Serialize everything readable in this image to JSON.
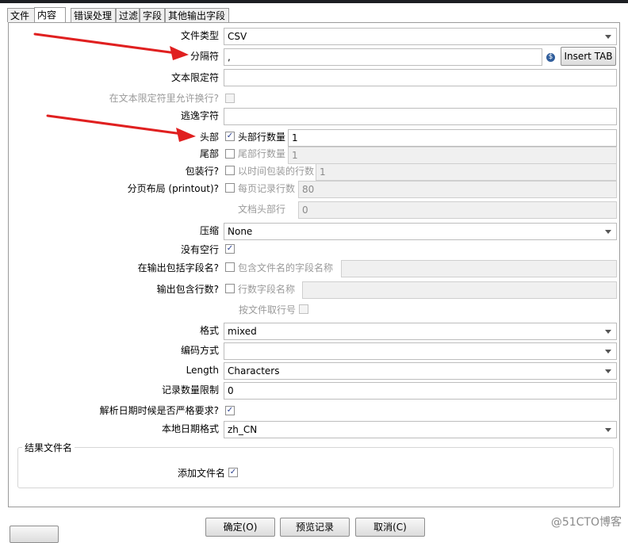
{
  "tabs": [
    "文件",
    "内容",
    "错误处理",
    "过滤",
    "字段",
    "其他输出字段"
  ],
  "form": {
    "file_type": {
      "label": "文件类型",
      "value": "CSV"
    },
    "separator": {
      "label": "分隔符",
      "value": ",",
      "insert_tab": "Insert TAB"
    },
    "enclosure": {
      "label": "文本限定符",
      "value": ""
    },
    "allow_breaks": {
      "label": "在文本限定符里允许换行?"
    },
    "escape": {
      "label": "逃逸字符",
      "value": ""
    },
    "header": {
      "label": "头部",
      "checked": true,
      "sub_label": "头部行数量",
      "value": "1"
    },
    "footer": {
      "label": "尾部",
      "checked": false,
      "sub_label": "尾部行数量",
      "value": "1"
    },
    "wrapped": {
      "label": "包装行?",
      "checked": false,
      "sub_label": "以时间包装的行数",
      "value": "1"
    },
    "paged": {
      "label": "分页布局 (printout)?",
      "checked": false,
      "sub_label": "每页记录行数",
      "value": "80"
    },
    "doc_header": {
      "label": "文档头部行",
      "value": "0"
    },
    "compression": {
      "label": "压缩",
      "value": "None"
    },
    "no_empty_rows": {
      "label": "没有空行",
      "checked": true
    },
    "include_filename": {
      "label": "在输出包括字段名?",
      "checked": false,
      "sub_label": "包含文件名的字段名称",
      "value": ""
    },
    "include_rownum": {
      "label": "输出包含行数?",
      "checked": false,
      "sub_label": "行数字段名称",
      "value": ""
    },
    "rownum_by_file": {
      "label": "按文件取行号",
      "checked": false
    },
    "format": {
      "label": "格式",
      "value": "mixed"
    },
    "encoding": {
      "label": "编码方式",
      "value": ""
    },
    "length": {
      "label": "Length",
      "value": "Characters"
    },
    "limit": {
      "label": "记录数量限制",
      "value": "0"
    },
    "lenient_date": {
      "label": "解析日期时候是否严格要求?",
      "checked": true
    },
    "locale": {
      "label": "本地日期格式",
      "value": "zh_CN"
    }
  },
  "result_group": {
    "title": "结果文件名",
    "add_filename_label": "添加文件名",
    "checked": true
  },
  "buttons": {
    "ok": "确定(O)",
    "preview": "预览记录",
    "cancel": "取消(C)"
  },
  "watermark": "@51CTO博客",
  "colors": {
    "arrow": "#e02020",
    "check": "#2a3f8f"
  }
}
